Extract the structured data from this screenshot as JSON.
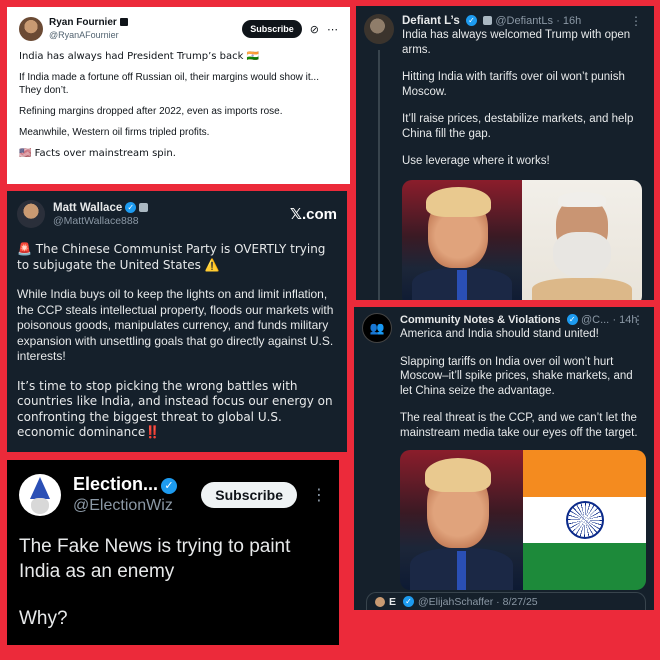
{
  "card1": {
    "name": "Ryan Fournier",
    "handle": "@RyanAFournier",
    "subscribe": "Subscribe",
    "grok_icon": "⊘",
    "more_icon": "⋯",
    "paragraphs": [
      "India has always had President Trump’s back 🇮🇳",
      "If India made a fortune off Russian oil, their margins would show it... They don’t.",
      "Refining margins dropped after 2022, even as imports rose.",
      "Meanwhile, Western oil firms tripled profits.",
      "🇺🇸 Facts over mainstream spin."
    ]
  },
  "card2": {
    "name": "Defiant L’s",
    "badge_text": "✓",
    "handle": "@DefiantLs",
    "time": "· 16h",
    "more_icon": "⋮",
    "paragraphs": [
      "India has always welcomed Trump with open arms.",
      "Hitting India with tariffs over oil won’t punish Moscow.",
      "It’ll raise prices, destabilize markets, and help China fill the gap.",
      "Use leverage where it works!"
    ]
  },
  "card3": {
    "name": "Matt Wallace",
    "badge_text": "✓",
    "handle": "@MattWallace888",
    "xcom": "𝕏.com",
    "paragraphs": [
      "🚨 The Chinese Communist Party is OVERTLY trying to subjugate the United States ⚠️",
      "While India buys oil to keep the lights on and limit inflation, the CCP steals intellectual property, floods our markets with poisonous goods, manipulates currency, and funds military expansion with unsettling goals that go directly against U.S. interests!",
      "It’s time to stop picking the wrong battles with countries like India, and instead focus our energy on confronting the biggest threat to global U.S. economic dominance‼️"
    ]
  },
  "card4": {
    "name": "Community Notes & Violations",
    "badge_text": "✓",
    "handle": "@C...",
    "time": "· 14h",
    "more_icon": "⋮",
    "avatar_icon": "👥",
    "paragraphs": [
      "America and India should stand united!",
      "Slapping tariffs on India over oil won’t hurt Moscow–it’ll spike prices, shake markets, and let China seize the advantage.",
      "The real threat is the CCP, and we can’t let the mainstream media take our eyes off the target."
    ],
    "quote_name": "E",
    "quote_handle": "@ElijahSchaffer · 8/27/25"
  },
  "card5": {
    "name": "Election...",
    "badge_text": "✓",
    "handle": "@ElectionWiz",
    "subscribe": "Subscribe",
    "more_icon": "⋮",
    "paragraphs": [
      "The Fake News is trying to paint India as an enemy",
      "Why?"
    ]
  }
}
